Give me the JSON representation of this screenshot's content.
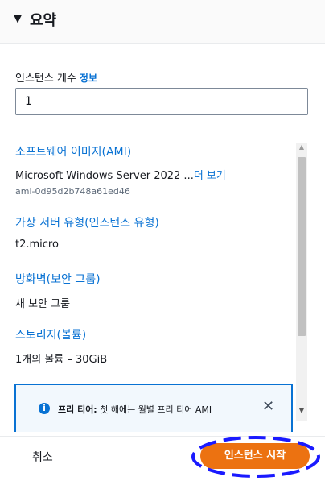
{
  "summary": {
    "title": "요약"
  },
  "instance_count": {
    "label": "인스턴스 개수",
    "info_link": "정보",
    "value": "1"
  },
  "details": {
    "ami": {
      "title": "소프트웨어 이미지(AMI)",
      "value": "Microsoft Windows Server 2022 ...",
      "more_link": "더 보기",
      "ami_id": "ami-0d95d2b748a61ed46"
    },
    "instance_type": {
      "title": "가상 서버 유형(인스턴스 유형)",
      "value": "t2.micro"
    },
    "firewall": {
      "title": "방화벽(보안 그룹)",
      "value": "새 보안 그룹"
    },
    "storage": {
      "title": "스토리지(볼륨)",
      "value": "1개의 볼륨 – 30GiB"
    }
  },
  "free_tier_alert": {
    "icon": "info-icon",
    "bold": "프리 티어:",
    "text": " 첫 해에는 월별 프리 티어 AMI",
    "close_icon": "close-icon"
  },
  "footer": {
    "cancel_label": "취소",
    "launch_label": "인스턴스 시작"
  },
  "colors": {
    "link": "#0972d3",
    "primary_button": "#ec7211",
    "annotation": "#1a1aff",
    "alert_border": "#0972d3"
  }
}
